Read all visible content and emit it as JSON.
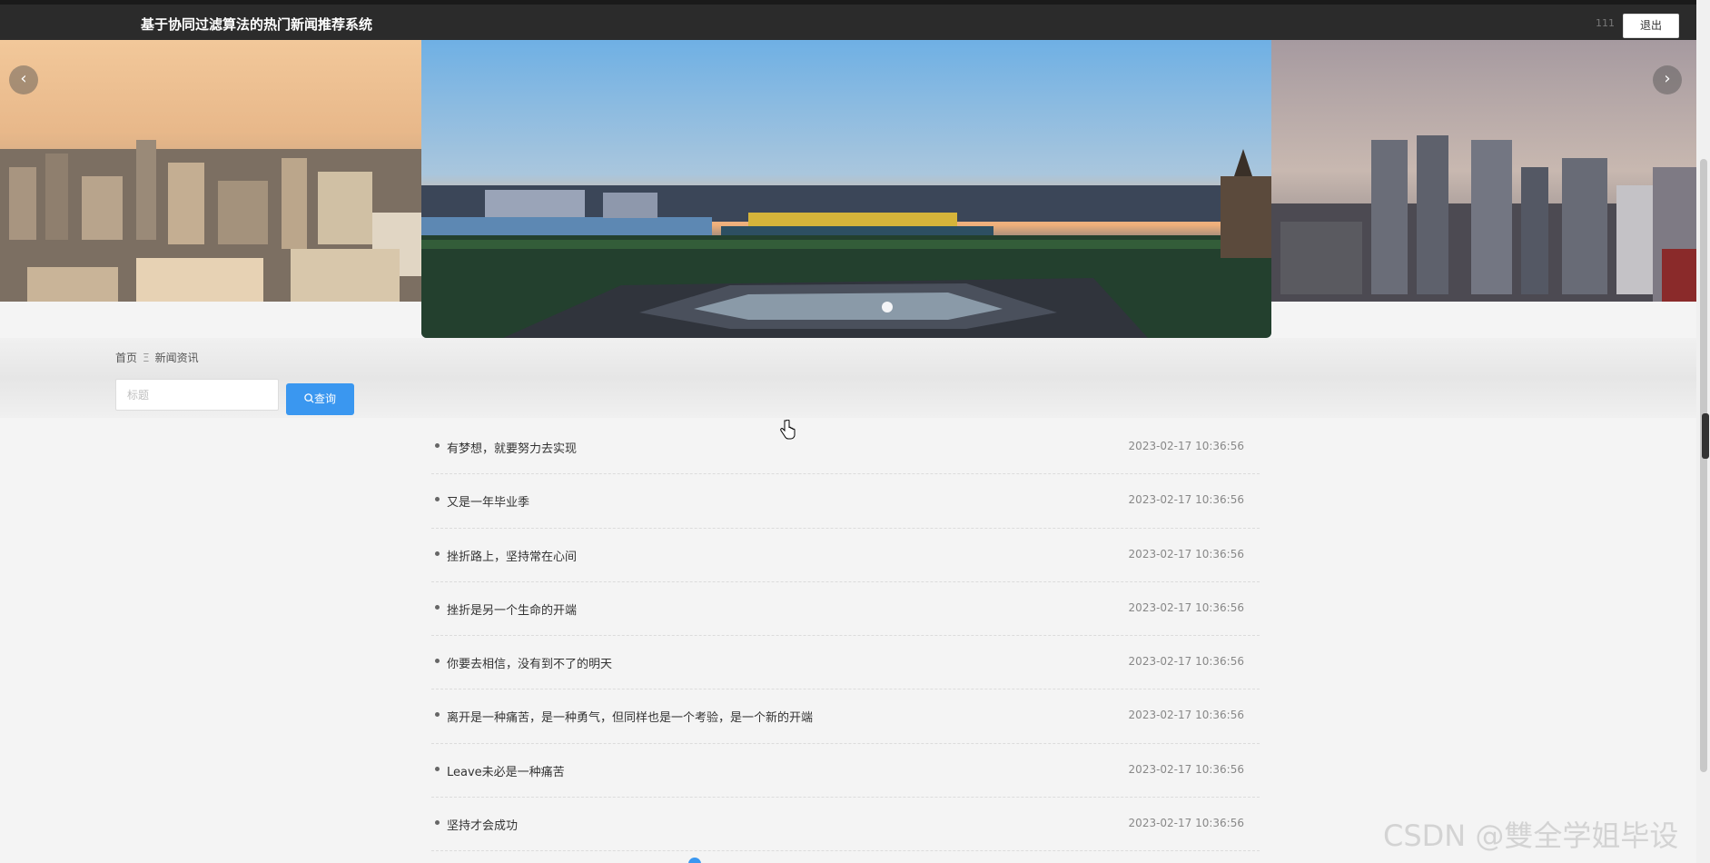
{
  "header": {
    "title": "基于协同过滤算法的热门新闻推荐系统",
    "username": "111",
    "logout_label": "退出"
  },
  "carousel": {
    "prev_glyph": "‹",
    "next_glyph": "›",
    "slides": [
      "city-dusk-left",
      "riverside-night-center",
      "skyline-right"
    ],
    "active_index": 1
  },
  "breadcrumb": {
    "home": "首页",
    "separator": "Ξ",
    "current": "新闻资讯"
  },
  "search": {
    "placeholder": "标题",
    "value": "",
    "button_icon": "search-icon",
    "button_label": "查询"
  },
  "news": [
    {
      "title": "有梦想，就要努力去实现",
      "time": "2023-02-17 10:36:56"
    },
    {
      "title": "又是一年毕业季",
      "time": "2023-02-17 10:36:56"
    },
    {
      "title": "挫折路上，坚持常在心间",
      "time": "2023-02-17 10:36:56"
    },
    {
      "title": "挫折是另一个生命的开端",
      "time": "2023-02-17 10:36:56"
    },
    {
      "title": "你要去相信，没有到不了的明天",
      "time": "2023-02-17 10:36:56"
    },
    {
      "title": "离开是一种痛苦，是一种勇气，但同样也是一个考验，是一个新的开端",
      "time": "2023-02-17 10:36:56"
    },
    {
      "title": "Leave未必是一种痛苦",
      "time": "2023-02-17 10:36:56"
    },
    {
      "title": "坚持才会成功",
      "time": "2023-02-17 10:36:56"
    }
  ],
  "watermark": "CSDN @雙全学姐毕设",
  "colors": {
    "header_bg": "#2b2b2b",
    "accent": "#3a97f0",
    "page_bg": "#f4f4f4"
  }
}
